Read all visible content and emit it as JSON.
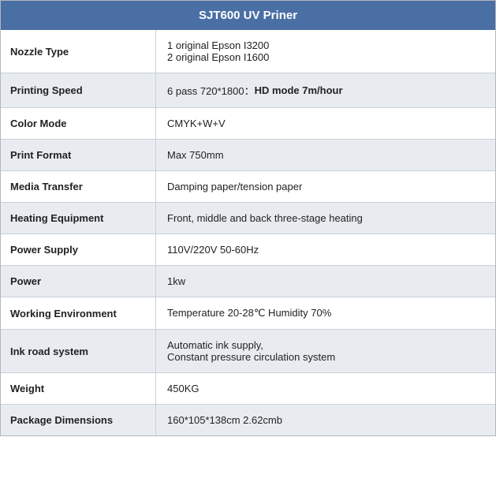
{
  "table": {
    "title": "SJT600 UV Priner",
    "rows": [
      {
        "id": "nozzle-type",
        "label": "Nozzle Type",
        "value": "1 original Epson I3200\n2 original Epson I1600",
        "shaded": false
      },
      {
        "id": "printing-speed",
        "label": "Printing Speed",
        "value": "6 pass 720*1800：HD mode 7m/hour",
        "shaded": true
      },
      {
        "id": "color-mode",
        "label": "Color Mode",
        "value": "CMYK+W+V",
        "shaded": false
      },
      {
        "id": "print-format",
        "label": "Print Format",
        "value": "Max 750mm",
        "shaded": true
      },
      {
        "id": "media-transfer",
        "label": "Media Transfer",
        "value": "Damping paper/tension paper",
        "shaded": false
      },
      {
        "id": "heating-equipment",
        "label": "Heating Equipment",
        "value": "Front, middle and back three-stage heating",
        "shaded": true
      },
      {
        "id": "power-supply",
        "label": "Power Supply",
        "value": "110V/220V 50-60Hz",
        "shaded": false
      },
      {
        "id": "power",
        "label": "Power",
        "value": "1kw",
        "shaded": true
      },
      {
        "id": "working-environment",
        "label": "Working Environment",
        "value": "Temperature 20-28℃ Humidity 70%",
        "shaded": false
      },
      {
        "id": "ink-road-system",
        "label": "Ink road system",
        "value": "Automatic ink supply,\nConstant pressure circulation system",
        "shaded": true
      },
      {
        "id": "weight",
        "label": "Weight",
        "value": "450KG",
        "shaded": false
      },
      {
        "id": "package-dimensions",
        "label": "Package Dimensions",
        "value": "160*105*138cm 2.62cmb",
        "shaded": true
      }
    ]
  }
}
